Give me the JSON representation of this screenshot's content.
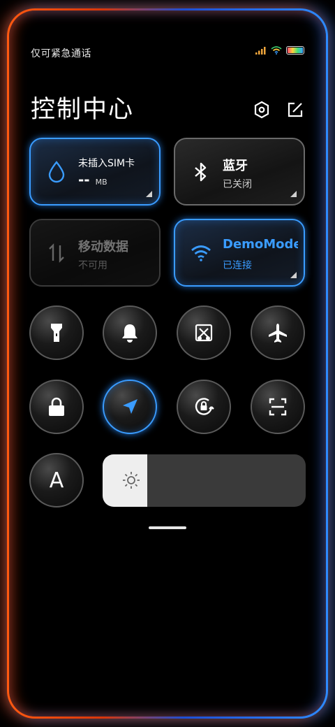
{
  "status": {
    "carrier_text": "仅可紧急通话"
  },
  "title": "控制中心",
  "tiles": {
    "data_usage": {
      "label": "未插入SIM卡",
      "value": "--",
      "unit": "MB"
    },
    "bluetooth": {
      "label": "蓝牙",
      "status": "已关闭"
    },
    "mobile_data": {
      "label": "移动数据",
      "status": "不可用"
    },
    "wifi": {
      "label": "DemoMode",
      "status": "已连接"
    }
  },
  "toggles": [
    {
      "icon": "flashlight-icon",
      "active": false
    },
    {
      "icon": "bell-icon",
      "active": false
    },
    {
      "icon": "screenshot-icon",
      "active": false
    },
    {
      "icon": "airplane-icon",
      "active": false
    },
    {
      "icon": "lock-icon",
      "active": false
    },
    {
      "icon": "location-icon",
      "active": true
    },
    {
      "icon": "rotation-lock-icon",
      "active": false
    },
    {
      "icon": "scan-icon",
      "active": false
    },
    {
      "icon": "auto-brightness-icon",
      "active": false,
      "label": "A"
    }
  ],
  "brightness": {
    "level": 0.22
  },
  "colors": {
    "accent_blue": "#3a9cff",
    "blue_text": "#3a9cff"
  }
}
